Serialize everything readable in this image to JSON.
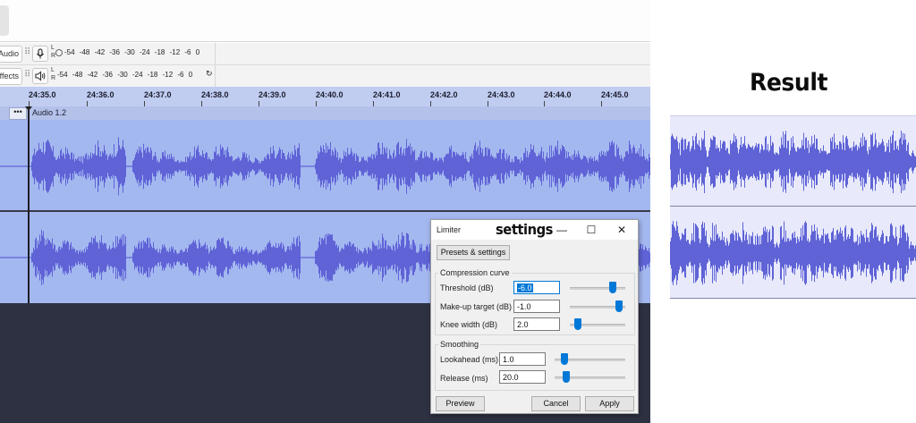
{
  "toolbar": {
    "recording_device_label": "Audio",
    "playback_device_label": "Effects",
    "recording_meter": {
      "channels": [
        "L",
        "R"
      ],
      "scale": [
        "-54",
        "-48",
        "-42",
        "-36",
        "-30",
        "-24",
        "-18",
        "-12",
        "-6",
        "0"
      ],
      "icon": "microphone-icon"
    },
    "playback_meter": {
      "channels": [
        "L",
        "R"
      ],
      "scale": [
        "-54",
        "-48",
        "-42",
        "-36",
        "-30",
        "-24",
        "-18",
        "-12",
        "-6",
        "0"
      ],
      "icon": "speaker-icon"
    }
  },
  "timeline": {
    "ticks": [
      "24:35.0",
      "24:36.0",
      "24:37.0",
      "24:38.0",
      "24:39.0",
      "24:40.0",
      "24:41.0",
      "24:42.0",
      "24:43.0",
      "24:44.0",
      "24:45.0"
    ]
  },
  "track": {
    "name": "Audio 1.2",
    "menu_label": "•••",
    "channels": 2,
    "waveform_color": "#5f63d6",
    "background_color": "#a4b8f0"
  },
  "dialog": {
    "title": "Limiter",
    "annotation": "settings",
    "presets_button": "Presets & settings",
    "compression_group": "Compression curve",
    "threshold_label": "Threshold (dB)",
    "threshold_value": "-6.0",
    "threshold_level": 0.82,
    "makeup_label": "Make-up target (dB)",
    "makeup_value": "-1.0",
    "makeup_level": 0.95,
    "knee_label": "Knee width (dB)",
    "knee_value": "2.0",
    "knee_level": 0.1,
    "smoothing_group": "Smoothing",
    "lookahead_label": "Lookahead (ms)",
    "lookahead_value": "1.0",
    "lookahead_level": 0.1,
    "release_label": "Release (ms)",
    "release_value": "20.0",
    "release_level": 0.12,
    "preview_button": "Preview",
    "cancel_button": "Cancel",
    "apply_button": "Apply",
    "minimize_icon": "minimize-icon",
    "maximize_icon": "maximize-icon",
    "close_icon": "close-icon",
    "accent_color": "#0078d7"
  },
  "result": {
    "title": "Result",
    "background_color": "#e8eafb"
  }
}
